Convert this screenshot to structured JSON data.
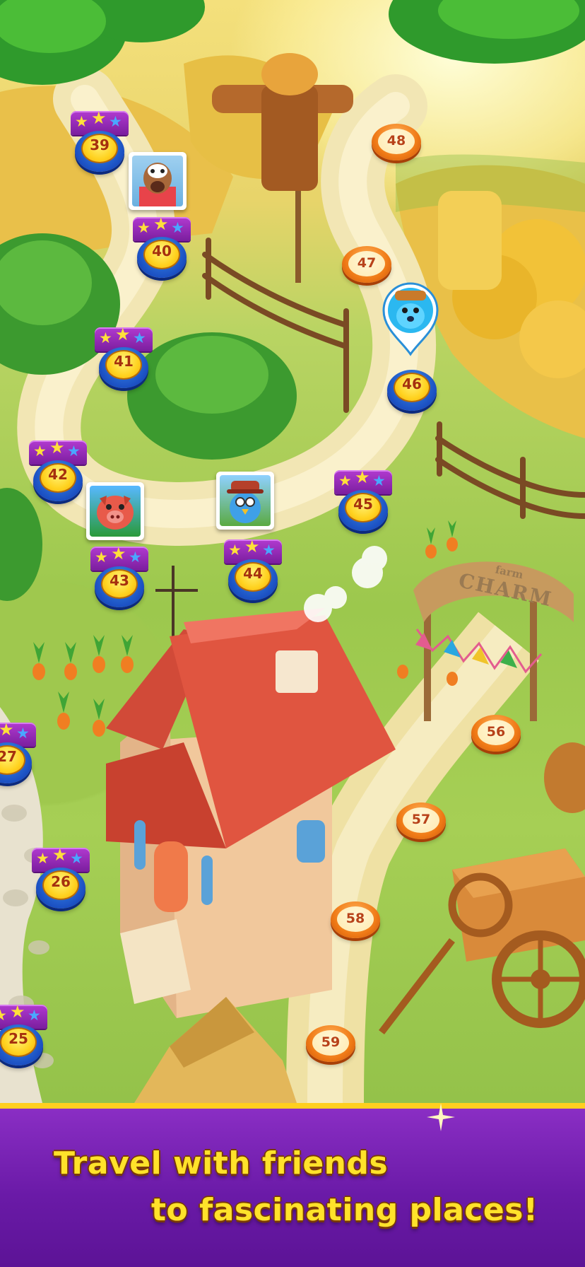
{
  "map": {
    "completed_levels": [
      {
        "label": "39",
        "stars": 3
      },
      {
        "label": "40",
        "stars": 3
      },
      {
        "label": "41",
        "stars": 3
      },
      {
        "label": "42",
        "stars": 3
      },
      {
        "label": "43",
        "stars": 3
      },
      {
        "label": "44",
        "stars": 3
      },
      {
        "label": "45",
        "stars": 3
      },
      {
        "label": "46",
        "stars": 0
      },
      {
        "label": "27",
        "stars": 3
      },
      {
        "label": "26",
        "stars": 3
      },
      {
        "label": "25",
        "stars": 3
      }
    ],
    "locked_levels": [
      "48",
      "47",
      "56",
      "57",
      "58",
      "59"
    ],
    "sign_text_top": "farm",
    "sign_text_bottom": "CHARM",
    "friend_avatars": [
      "cow-avatar",
      "pig-avatar",
      "bird-avatar"
    ],
    "player_marker": "raccoon-player-marker"
  },
  "banner": {
    "line1": "Travel with friends",
    "line2": "to fascinating places!"
  },
  "colors": {
    "banner_purple": "#6a1aa7",
    "banner_border": "#ffcf1f",
    "text_yellow": "#ffe22a",
    "level_blue": "#1b4fc2",
    "level_gold": "#ffd21f",
    "level_orange": "#f07b17"
  }
}
